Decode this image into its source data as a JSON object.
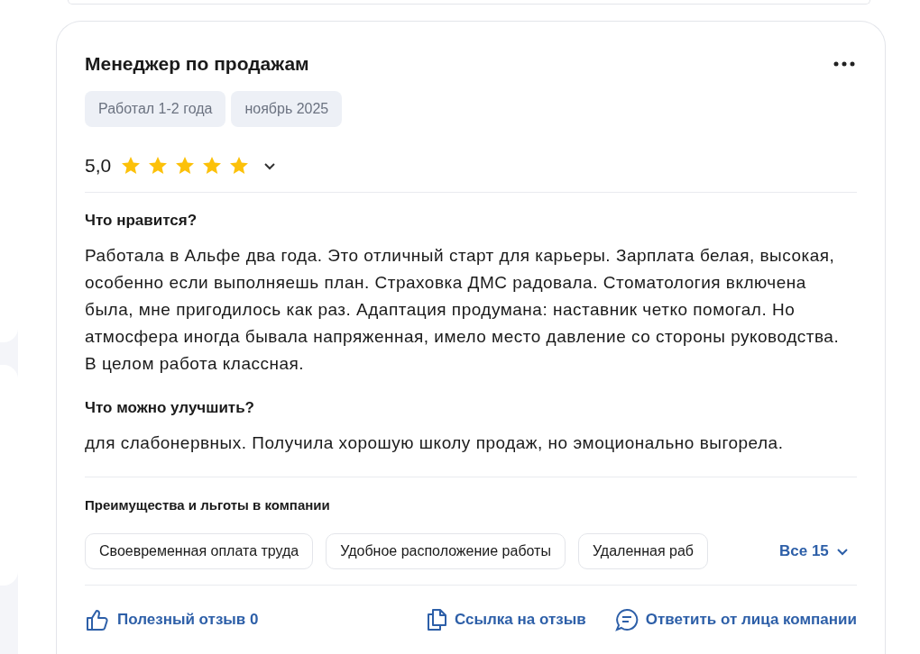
{
  "review": {
    "title": "Менеджер по продажам",
    "tags": [
      "Работал 1-2 года",
      "ноябрь 2025"
    ],
    "rating": "5,0",
    "stars": 5,
    "sections": [
      {
        "heading": "Что нравится?",
        "text": "Работала в Альфе два года. Это отличный старт для карьеры. Зарплата белая, высокая, особенно если выполняешь план. Страховка ДМС радовала. Стоматология включена была, мне пригодилось как раз. Адаптация продумана: наставник четко помогал. Но атмосфера иногда бывала напряженная, имело место давление со стороны руководства. В целом работа классная."
      },
      {
        "heading": "Что можно улучшить?",
        "text": "для слабонервных. Получила хорошую школу продаж, но эмоционально выгорела."
      }
    ],
    "benefits": {
      "heading": "Преимущества и льготы в компании",
      "items": [
        "Своевременная оплата труда",
        "Удобное расположение работы",
        "Удаленная раб"
      ],
      "more": "Все 15"
    },
    "actions": [
      {
        "kind": "like",
        "label": "Полезный отзыв 0"
      },
      {
        "kind": "copy",
        "label": "Ссылка на отзыв"
      },
      {
        "kind": "reply",
        "label": "Ответить от лица компании"
      }
    ]
  }
}
